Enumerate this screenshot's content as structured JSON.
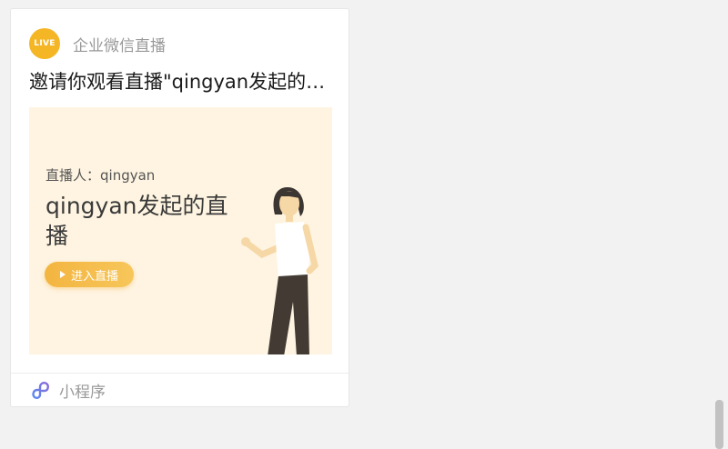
{
  "message_card": {
    "source_badge": "LIVE",
    "source_name": "企业微信直播",
    "title": "邀请你观看直播\"qingyan发起的直播\"",
    "poster": {
      "host_label": "直播人：qingyan",
      "title": "qingyan发起的直播",
      "enter_button_label": "进入直播"
    },
    "footer": {
      "icon": "mini-program-icon",
      "label": "小程序"
    }
  },
  "colors": {
    "badge": "#f5b625",
    "poster_bg": "#fef4e1",
    "button": "#f3b540",
    "mini_program_icon": "#7a6bd6"
  }
}
